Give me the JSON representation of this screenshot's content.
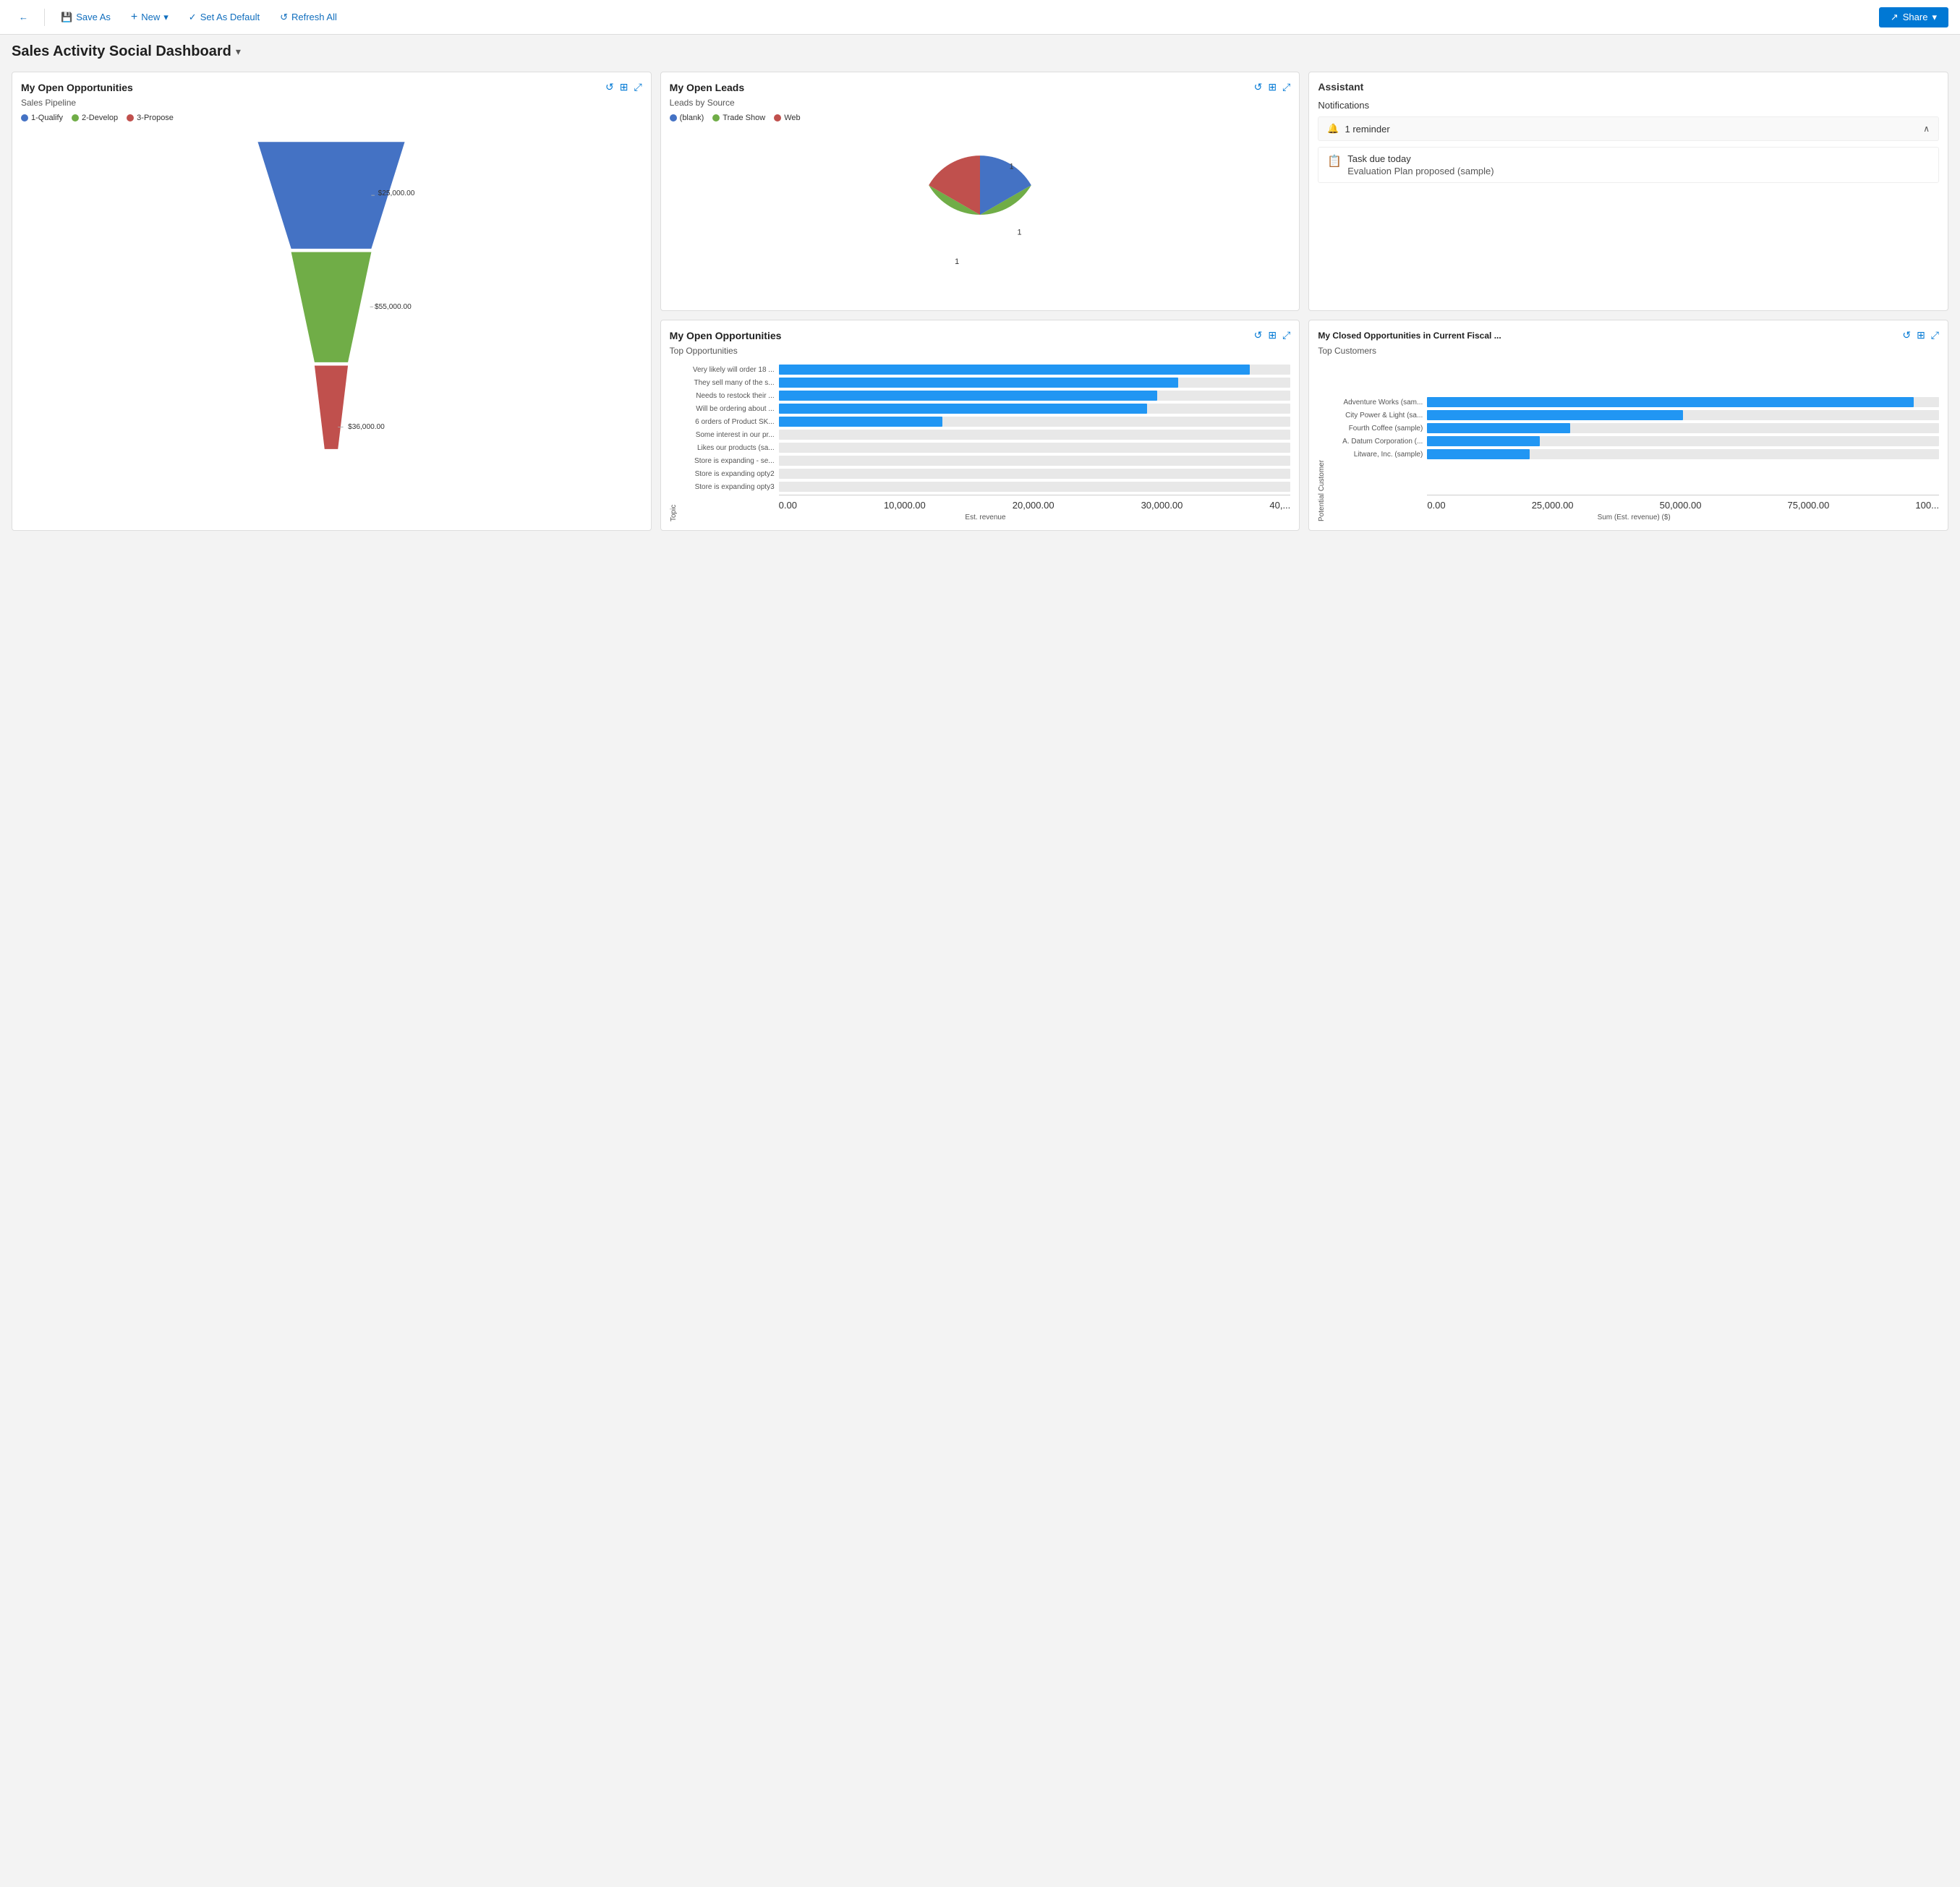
{
  "toolbar": {
    "back_icon": "←",
    "save_as_icon": "💾",
    "save_as_label": "Save As",
    "new_icon": "+",
    "new_label": "New",
    "new_chevron": "▾",
    "set_default_icon": "✓",
    "set_default_label": "Set As Default",
    "refresh_icon": "↺",
    "refresh_label": "Refresh All",
    "share_icon": "↗",
    "share_label": "Share",
    "share_chevron": "▾"
  },
  "page": {
    "title": "Sales Activity Social Dashboard",
    "title_chevron": "▾"
  },
  "open_opportunities": {
    "title": "My Open Opportunities",
    "subtitle": "Sales Pipeline",
    "legend": [
      {
        "label": "1-Qualify",
        "color": "#4472c4"
      },
      {
        "label": "2-Develop",
        "color": "#70ad47"
      },
      {
        "label": "3-Propose",
        "color": "#c0504d"
      }
    ],
    "funnel_segments": [
      {
        "label": "$25,000.00",
        "color": "#4472c4",
        "widthPct": 100
      },
      {
        "label": "$55,000.00",
        "color": "#70ad47",
        "widthPct": 72
      },
      {
        "label": "$36,000.00",
        "color": "#c0504d",
        "widthPct": 40
      }
    ]
  },
  "open_leads": {
    "title": "My Open Leads",
    "subtitle": "Leads by Source",
    "legend": [
      {
        "label": "(blank)",
        "color": "#4472c4"
      },
      {
        "label": "Trade Show",
        "color": "#70ad47"
      },
      {
        "label": "Web",
        "color": "#c0504d"
      }
    ],
    "pie_segments": [
      {
        "label": "1",
        "color": "#4472c4",
        "value": 1,
        "startAngle": 0,
        "endAngle": 120
      },
      {
        "label": "1",
        "color": "#70ad47",
        "value": 1,
        "startAngle": 120,
        "endAngle": 240
      },
      {
        "label": "1",
        "color": "#c0504d",
        "value": 1,
        "startAngle": 240,
        "endAngle": 360
      }
    ]
  },
  "assistant": {
    "title": "Assistant",
    "notifications_title": "Notifications",
    "reminder_label": "1 reminder",
    "task_primary": "Task due today",
    "task_secondary": "Evaluation Plan proposed (sample)"
  },
  "top_opportunities": {
    "title": "My Open Opportunities",
    "subtitle": "Top Opportunities",
    "x_axis_label": "Est. revenue",
    "y_axis_label": "Topic",
    "bars": [
      {
        "label": "Very likely will order 18 ...",
        "widthPct": 92
      },
      {
        "label": "They sell many of the s...",
        "widthPct": 78
      },
      {
        "label": "Needs to restock their ...",
        "widthPct": 74
      },
      {
        "label": "Will be ordering about ...",
        "widthPct": 72
      },
      {
        "label": "6 orders of Product SK...",
        "widthPct": 32
      },
      {
        "label": "Some interest in our pr...",
        "widthPct": 0
      },
      {
        "label": "Likes our products (sa...",
        "widthPct": 0
      },
      {
        "label": "Store is expanding - se...",
        "widthPct": 0
      },
      {
        "label": "Store is expanding opty2",
        "widthPct": 0
      },
      {
        "label": "Store is expanding opty3",
        "widthPct": 0
      }
    ],
    "x_axis_ticks": [
      "0.00",
      "10,000.00",
      "20,000.00",
      "30,000.00",
      "40,..."
    ]
  },
  "closed_opportunities": {
    "title": "My Closed Opportunities in Current Fiscal ...",
    "subtitle": "Top Customers",
    "x_axis_label": "Sum (Est. revenue) ($)",
    "y_axis_label": "Potential Customer",
    "bars": [
      {
        "label": "Adventure Works (sam...",
        "widthPct": 95
      },
      {
        "label": "City Power & Light (sa...",
        "widthPct": 50
      },
      {
        "label": "Fourth Coffee (sample)",
        "widthPct": 28
      },
      {
        "label": "A. Datum Corporation (...",
        "widthPct": 22
      },
      {
        "label": "Litware, Inc. (sample)",
        "widthPct": 20
      }
    ],
    "x_axis_ticks": [
      "0.00",
      "25,000.00",
      "50,000.00",
      "75,000.00",
      "100..."
    ]
  }
}
